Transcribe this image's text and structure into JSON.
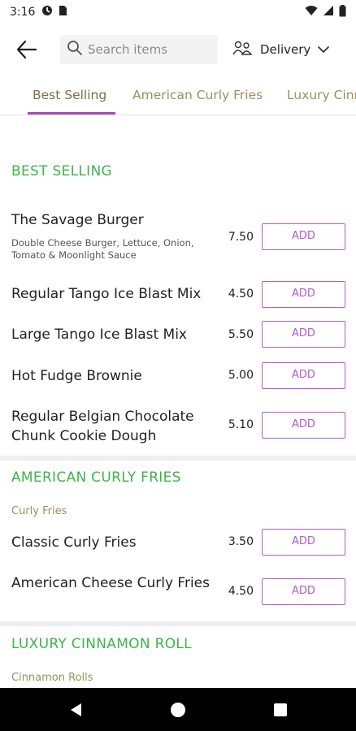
{
  "status_bar": {
    "time": "3:16",
    "icons": [
      "data-saver-icon",
      "sim-card-icon",
      "wifi-icon",
      "cellular-signal-icon",
      "battery-icon"
    ]
  },
  "top_bar": {
    "search_placeholder": "Search items",
    "delivery_label": "Delivery"
  },
  "tabs": [
    "Best Selling",
    "American Curly Fries",
    "Luxury Cinnamon Roll"
  ],
  "active_tab": 0,
  "accent_color": "#a24db2",
  "section_color": "#3cb54a",
  "sections": [
    {
      "title": "BEST SELLING",
      "items": [
        {
          "name": "The Savage Burger",
          "description": "Double Cheese Burger, Lettuce, Onion, Tomato & Moonlight Sauce",
          "price": "7.50",
          "button": "ADD"
        },
        {
          "name": "Regular Tango Ice Blast Mix",
          "price": "4.50",
          "button": "ADD"
        },
        {
          "name": "Large Tango Ice Blast Mix",
          "price": "5.50",
          "button": "ADD"
        },
        {
          "name": "Hot Fudge Brownie",
          "price": "5.00",
          "button": "ADD"
        },
        {
          "name": "Regular Belgian Chocolate Chunk Cookie Dough",
          "price": "5.10",
          "button": "ADD"
        }
      ]
    },
    {
      "title": "AMERICAN CURLY FRIES",
      "subtitle": "Curly Fries",
      "items": [
        {
          "name": "Classic Curly Fries",
          "price": "3.50",
          "button": "ADD"
        },
        {
          "name": "American Cheese Curly Fries",
          "price": "4.50",
          "button": "ADD"
        }
      ]
    },
    {
      "title": "LUXURY CINNAMON ROLL",
      "subtitle": "Cinnamon Rolls"
    }
  ]
}
